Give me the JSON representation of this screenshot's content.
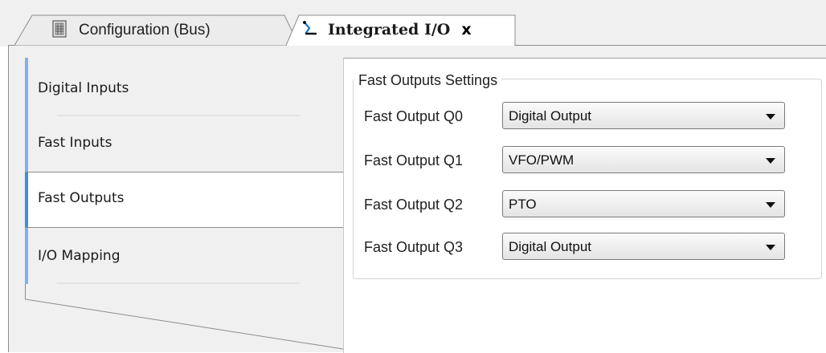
{
  "tabs": [
    {
      "label": "Configuration (Bus)",
      "icon": "bus-configuration-icon",
      "active": false
    },
    {
      "label": "Integrated I/O",
      "icon": "io-module-icon",
      "active": true,
      "close_label": "x"
    }
  ],
  "sidebar": {
    "items": [
      {
        "label": "Digital Inputs",
        "active": false
      },
      {
        "label": "Fast Inputs",
        "active": false
      },
      {
        "label": "Fast Outputs",
        "active": true
      },
      {
        "label": "I/O Mapping",
        "active": false
      }
    ],
    "accent_color": "#7fb2ea",
    "active_accent_color": "#3c8fe0"
  },
  "group": {
    "title": "Fast Outputs Settings",
    "rows": [
      {
        "label": "Fast Output Q0",
        "value": "Digital Output"
      },
      {
        "label": "Fast Output Q1",
        "value": "VFO/PWM"
      },
      {
        "label": "Fast Output Q2",
        "value": "PTO"
      },
      {
        "label": "Fast Output Q3",
        "value": "Digital Output"
      }
    ]
  }
}
